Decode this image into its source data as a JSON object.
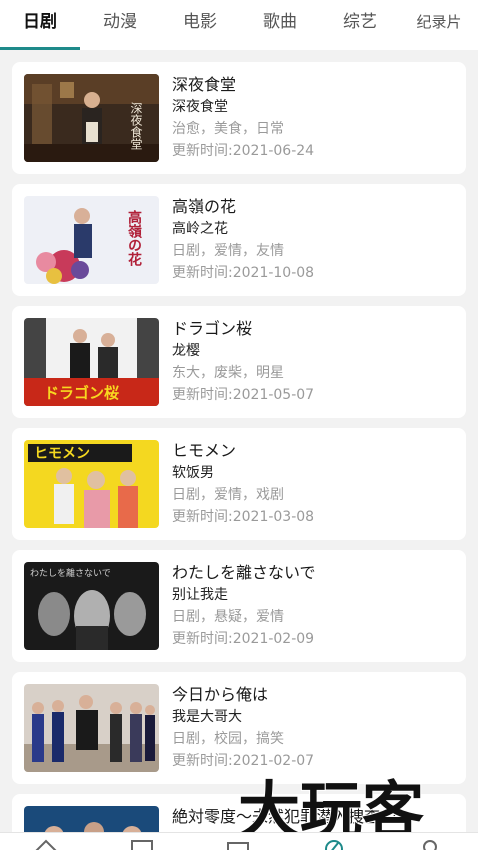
{
  "tabs": [
    {
      "label": "日剧",
      "active": true
    },
    {
      "label": "动漫",
      "active": false
    },
    {
      "label": "电影",
      "active": false
    },
    {
      "label": "歌曲",
      "active": false
    },
    {
      "label": "综艺",
      "active": false
    },
    {
      "label": "纪录片",
      "active": false
    }
  ],
  "dramas": [
    {
      "title": "深夜食堂",
      "subtitle": "深夜食堂",
      "tags": "治愈，美食，日常",
      "updated": "更新时间:2021-06-24"
    },
    {
      "title": "高嶺の花",
      "subtitle": "高岭之花",
      "tags": "日剧，爱情，友情",
      "updated": "更新时间:2021-10-08"
    },
    {
      "title": "ドラゴン桜",
      "subtitle": "龙樱",
      "tags": "东大，废柴，明星",
      "updated": "更新时间:2021-05-07"
    },
    {
      "title": "ヒモメン",
      "subtitle": "软饭男",
      "tags": "日剧，爱情，戏剧",
      "updated": "更新时间:2021-03-08"
    },
    {
      "title": "わたしを離さないで",
      "subtitle": "别让我走",
      "tags": "日剧，悬疑，爱情",
      "updated": "更新时间:2021-02-09"
    },
    {
      "title": "今日から俺は",
      "subtitle": "我是大哥大",
      "tags": "日剧，校园，搞笑",
      "updated": "更新时间:2021-02-07"
    },
    {
      "title": "絶対零度～未然犯罪潜入捜査～"
    }
  ],
  "posters": [
    {
      "text": "深夜食堂"
    },
    {
      "text": "高嶺の花"
    },
    {
      "text": "ドラゴン桜"
    },
    {
      "text": "ヒモメン"
    },
    {
      "text": "わたしを離さないで"
    }
  ],
  "watermark": "大玩客",
  "colors": {
    "accent": "#1e8a8a",
    "muted": "#9a9a9a",
    "background": "#f2f2f2"
  },
  "bottom_nav": [
    {
      "icon": "home-icon"
    },
    {
      "icon": "library-icon"
    },
    {
      "icon": "tv-icon"
    },
    {
      "icon": "discover-icon"
    },
    {
      "icon": "profile-icon"
    }
  ]
}
